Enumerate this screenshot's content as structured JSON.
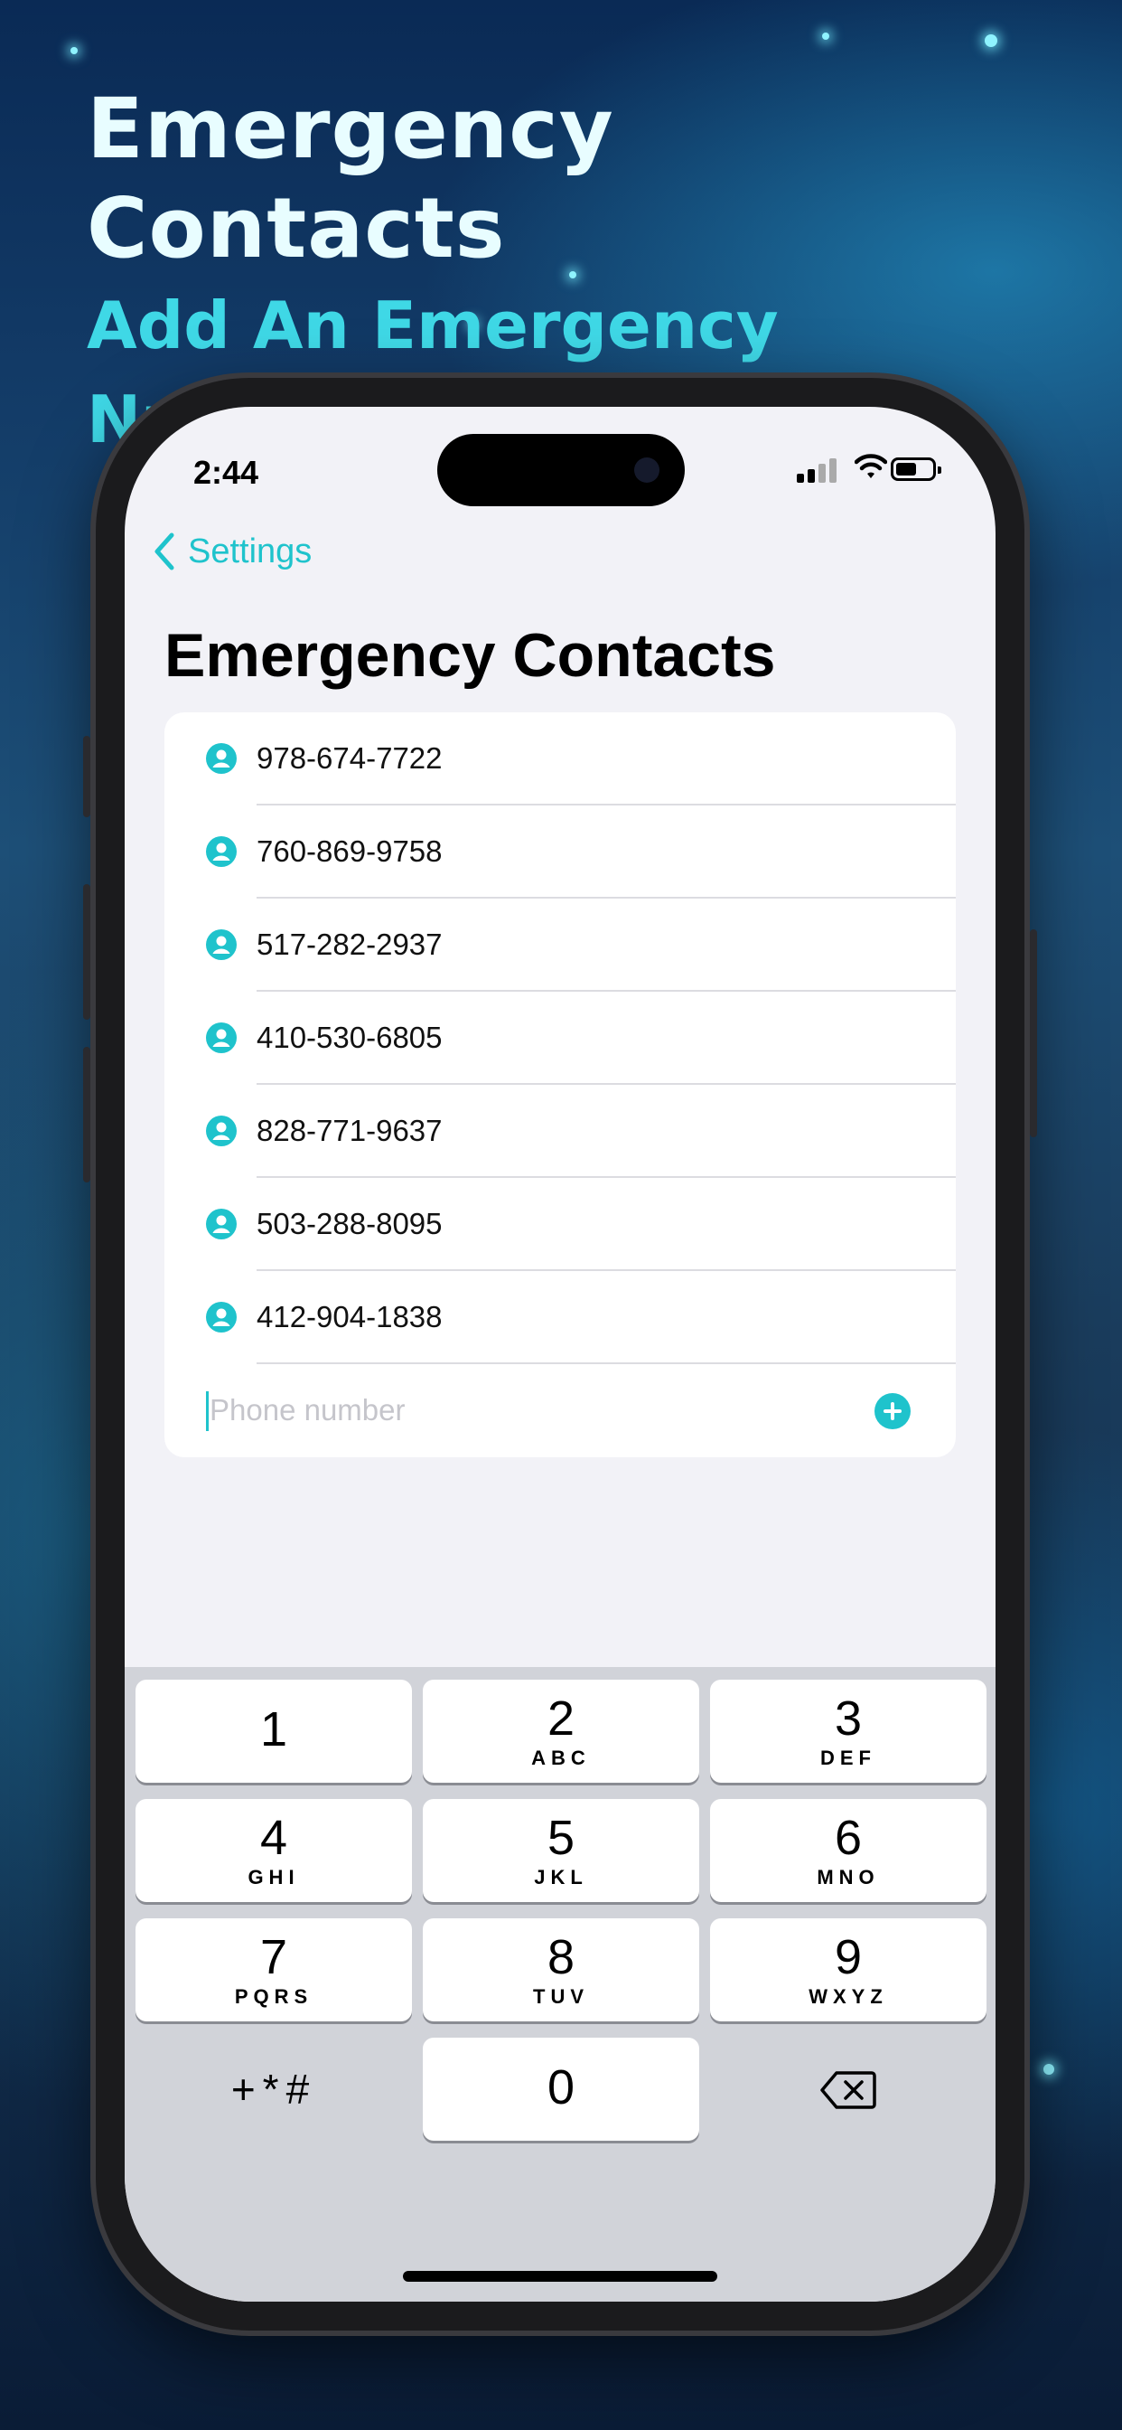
{
  "promo": {
    "headline": "Emergency Contacts",
    "subheadline": "Add An Emergency Number"
  },
  "status": {
    "time": "2:44"
  },
  "nav": {
    "back_label": "Settings",
    "title": "Emergency Contacts"
  },
  "contacts": [
    {
      "number": "978-674-7722"
    },
    {
      "number": "760-869-9758"
    },
    {
      "number": "517-282-2937"
    },
    {
      "number": "410-530-6805"
    },
    {
      "number": "828-771-9637"
    },
    {
      "number": "503-288-8095"
    },
    {
      "number": "412-904-1838"
    }
  ],
  "input": {
    "placeholder": "Phone number",
    "value": ""
  },
  "keypad": {
    "keys": [
      {
        "digit": "1",
        "letters": ""
      },
      {
        "digit": "2",
        "letters": "ABC"
      },
      {
        "digit": "3",
        "letters": "DEF"
      },
      {
        "digit": "4",
        "letters": "GHI"
      },
      {
        "digit": "5",
        "letters": "JKL"
      },
      {
        "digit": "6",
        "letters": "MNO"
      },
      {
        "digit": "7",
        "letters": "PQRS"
      },
      {
        "digit": "8",
        "letters": "TUV"
      },
      {
        "digit": "9",
        "letters": "WXYZ"
      },
      {
        "digit": "0",
        "letters": ""
      }
    ],
    "symbols_label": "+*#"
  },
  "colors": {
    "accent": "#1fc3cc",
    "headline": "#e8fdff",
    "subheadline": "#3fd8e6"
  },
  "icons": {
    "contact": "person-circle-icon",
    "add": "plus-circle-icon",
    "back": "chevron-left-icon",
    "delete": "backspace-icon"
  }
}
